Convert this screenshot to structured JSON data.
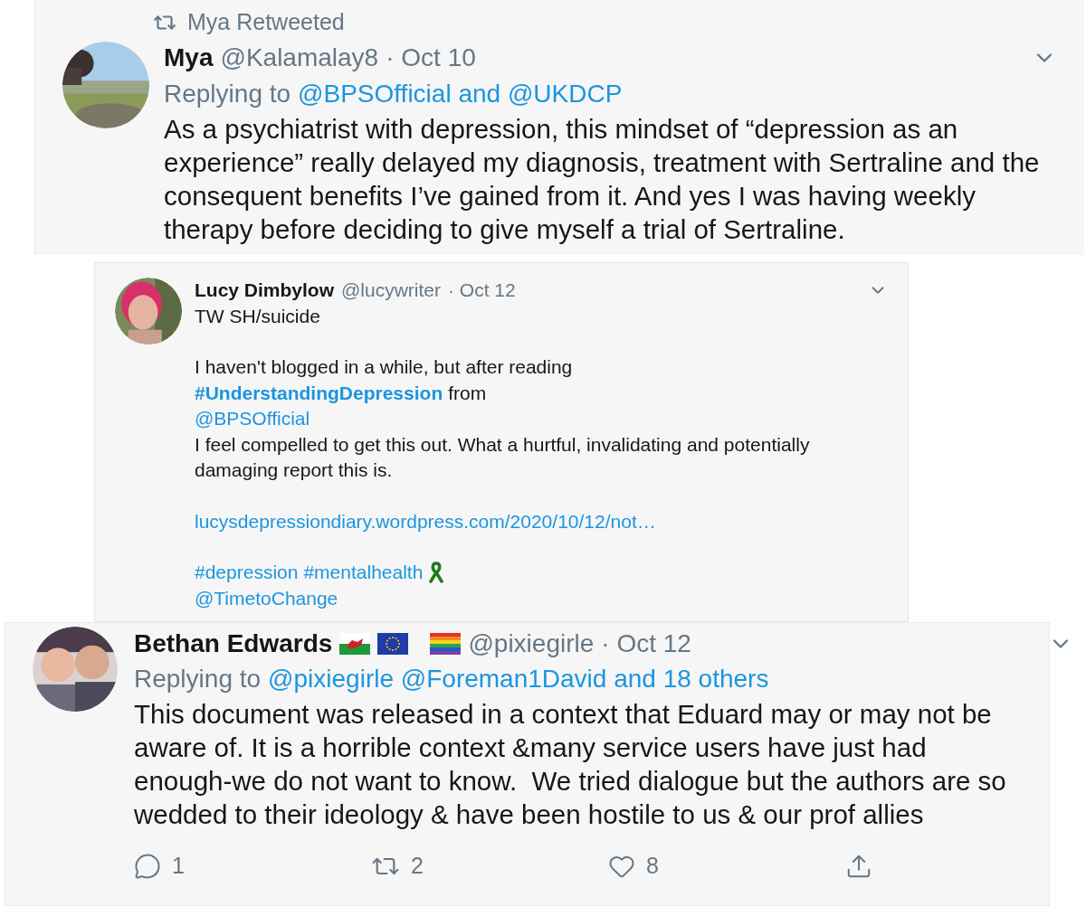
{
  "retweet": {
    "banner": "Mya Retweeted",
    "name": "Mya",
    "handle": "@Kalamalay8",
    "date": "· Oct 10",
    "replying_prefix": "Replying to",
    "replying_to": "@BPSOfficial and @UKDCP",
    "body": "As a psychiatrist with depression, this mindset of “depression as an experience” really delayed my diagnosis, treatment with Sertraline and the consequent benefits I’ve gained from it. And yes I was having weekly therapy before deciding to give myself a trial of Sertraline."
  },
  "quoted": {
    "name": "Lucy Dimbylow",
    "handle": "@lucywriter",
    "date": "· Oct 12",
    "paragraphs": [
      [
        [
          {
            "kind": "text",
            "text": "TW SH/suicide"
          }
        ]
      ],
      [
        [
          {
            "kind": "text",
            "text": "I haven't blogged in a while, but after reading"
          }
        ],
        [
          {
            "kind": "hashtag_bold",
            "text": "#UnderstandingDepression"
          },
          {
            "kind": "text",
            "text": "from"
          }
        ],
        [
          {
            "kind": "link",
            "text": "@BPSOfficial"
          }
        ],
        [
          {
            "kind": "text",
            "text": "I feel compelled to get this out. What a hurtful, invalidating and potentially damaging report this is."
          }
        ]
      ],
      [
        [
          {
            "kind": "link",
            "text": "lucysdepressiondiary.wordpress.com/2020/10/12/not…"
          }
        ]
      ],
      [
        [
          {
            "kind": "link",
            "text": "#depression"
          },
          {
            "kind": "link",
            "text": "#mentalhealth"
          },
          {
            "kind": "ribbon"
          }
        ],
        [
          {
            "kind": "link",
            "text": "@TimetoChange"
          }
        ]
      ]
    ]
  },
  "reply": {
    "name": "Bethan Edwards",
    "handle": "@pixiegirle",
    "date": "· Oct 12",
    "replying_prefix": "Replying to",
    "replying_to": "@pixiegirle @Foreman1David and 18 others",
    "body": "This document was released in a context that Eduard may or may not be aware of. It is a horrible context &many service users have just had enough-we do not want to know.  We tried dialogue but the authors are so wedded to their ideology & have been hostile to us & our prof allies",
    "actions": [
      {
        "kind": "reply",
        "count": "1"
      },
      {
        "kind": "retweet",
        "count": "2"
      },
      {
        "kind": "like",
        "count": "8"
      },
      {
        "kind": "share"
      }
    ]
  }
}
